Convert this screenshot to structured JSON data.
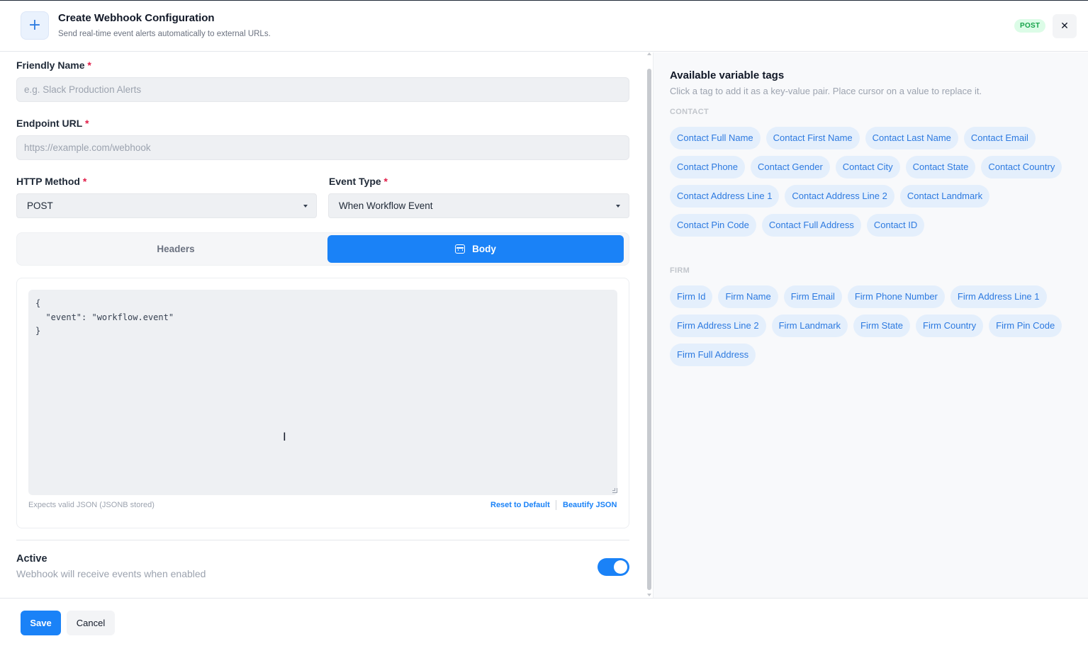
{
  "header": {
    "icon": "plus-icon",
    "icon_glyph": "+",
    "title": "Create Webhook Configuration",
    "subtitle": "Send real-time event alerts automatically to external URLs.",
    "method_badge": "POST",
    "close_glyph": "✕"
  },
  "form": {
    "friendly_name": {
      "label": "Friendly Name",
      "required_mark": "*",
      "value": "",
      "placeholder": "e.g. Slack Production Alerts"
    },
    "endpoint_url": {
      "label": "Endpoint URL",
      "required_mark": "*",
      "value": "",
      "placeholder": "https://example.com/webhook"
    },
    "http_method": {
      "label": "HTTP Method",
      "required_mark": "*",
      "selected": "POST"
    },
    "event_type": {
      "label": "Event Type",
      "required_mark": "*",
      "selected": "When Workflow Event"
    },
    "tabs": {
      "headers_label": "Headers",
      "body_label": "Body",
      "active": "Body"
    },
    "body_editor": {
      "content": "{\n  \"event\": \"workflow.event\"\n}",
      "hint": "Expects valid JSON (JSONB stored)",
      "reset_label": "Reset to Default",
      "beautify_label": "Beautify JSON"
    },
    "active": {
      "title": "Active",
      "description": "Webhook will receive events when enabled",
      "enabled": true
    }
  },
  "tags_panel": {
    "title": "Available variable tags",
    "subtitle": "Click a tag to add it as a key-value pair. Place cursor on a value to replace it.",
    "contact_heading": "CONTACT",
    "contact_tags": [
      "Contact Full Name",
      "Contact First Name",
      "Contact Last Name",
      "Contact Email",
      "Contact Phone",
      "Contact Gender",
      "Contact City",
      "Contact State",
      "Contact Country",
      "Contact Address Line 1",
      "Contact Address Line 2",
      "Contact Landmark",
      "Contact Pin Code",
      "Contact Full Address",
      "Contact ID"
    ],
    "firm_heading": "FIRM",
    "firm_tags": [
      "Firm Id",
      "Firm Name",
      "Firm Email",
      "Firm Phone Number",
      "Firm Address Line 1",
      "Firm Address Line 2",
      "Firm Landmark",
      "Firm State",
      "Firm Country",
      "Firm Pin Code",
      "Firm Full Address"
    ]
  },
  "footer": {
    "save_label": "Save",
    "cancel_label": "Cancel"
  },
  "colors": {
    "primary": "#1a82f7",
    "required": "#e11d48",
    "tag_bg": "#e4effc",
    "tag_text": "#2d7ae0",
    "badge_bg": "#dcfce7",
    "badge_text": "#16a34a"
  }
}
